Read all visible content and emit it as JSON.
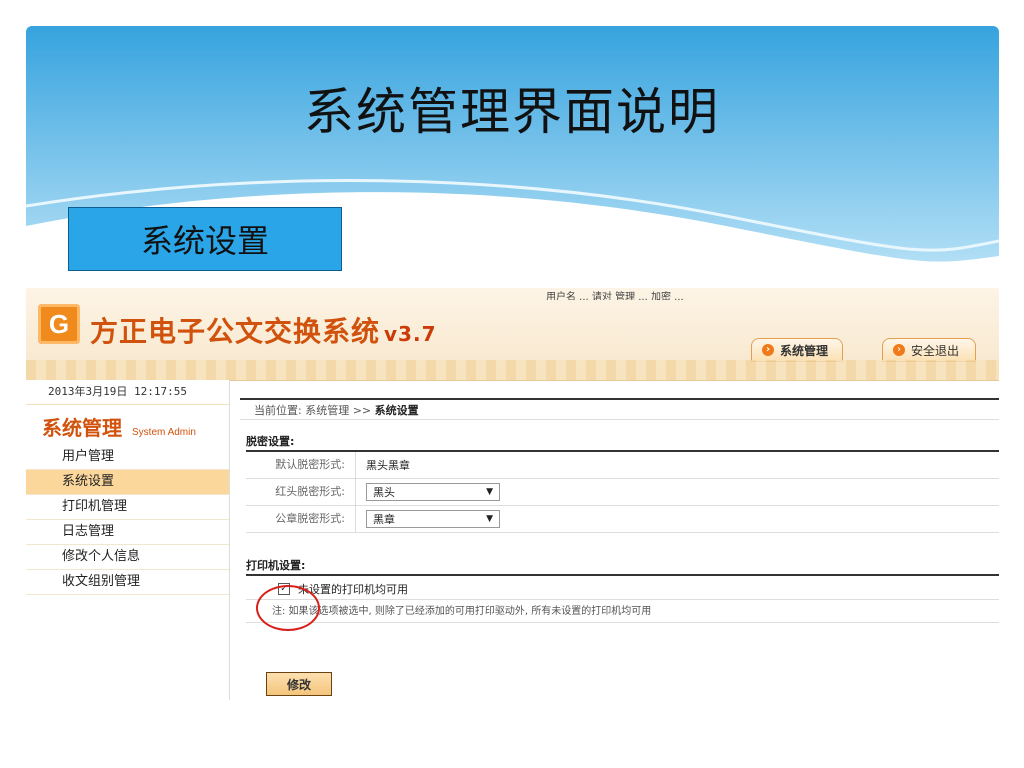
{
  "slide": {
    "title": "系统管理界面说明",
    "section_label": "系统设置"
  },
  "app": {
    "top_note": "用户名 ... 请对 管理 ... 加密 ...",
    "logo_mark": "G",
    "title": "方正电子公文交换系统",
    "version": "v3.7",
    "header_buttons": {
      "system_admin": "系统管理",
      "safe_exit": "安全退出"
    },
    "sidebar": {
      "datetime": "2013年3月19日 12:17:55",
      "heading": "系统管理",
      "heading_sub": "System Admin",
      "items": [
        {
          "label": "用户管理"
        },
        {
          "label": "系统设置"
        },
        {
          "label": "打印机管理"
        },
        {
          "label": "日志管理"
        },
        {
          "label": "修改个人信息"
        },
        {
          "label": "收文组别管理"
        }
      ]
    },
    "main": {
      "breadcrumb_prefix": "当前位置: 系统管理 >> ",
      "breadcrumb_current": "系统设置",
      "desensitize_section": "脱密设置:",
      "default_label": "默认脱密形式:",
      "default_value": "黑头黑章",
      "red_label": "红头脱密形式:",
      "red_value": "黑头",
      "seal_label": "公章脱密形式:",
      "seal_value": "黑章",
      "printer_section": "打印机设置:",
      "printer_checkbox_label": "未设置的打印机均可用",
      "printer_checkbox_checked": true,
      "note": "注: 如果该选项被选中, 则除了已经添加的可用打印驱动外, 所有未设置的打印机均可用",
      "submit_label": "修改"
    }
  }
}
